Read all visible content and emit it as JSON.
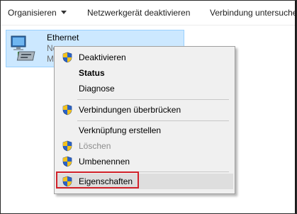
{
  "toolbar": {
    "organize_label": "Organisieren",
    "disable_label": "Netzwerkgerät deaktivieren",
    "diagnose_label": "Verbindung untersuche"
  },
  "network_item": {
    "name": "Ethernet",
    "status_partial": "Ne",
    "adapter_partial": "M"
  },
  "context_menu": {
    "items": [
      {
        "label": "Deaktivieren",
        "shield": true
      },
      {
        "label": "Status",
        "bold": true
      },
      {
        "label": "Diagnose"
      },
      {
        "label": "Verbindungen überbrücken",
        "shield": true
      },
      {
        "label": "Verknüpfung erstellen"
      },
      {
        "label": "Löschen",
        "shield": true,
        "disabled": true
      },
      {
        "label": "Umbenennen",
        "shield": true
      },
      {
        "label": "Eigenschaften",
        "shield": true,
        "highlighted": true
      }
    ]
  },
  "colors": {
    "selection_bg": "#cce8ff",
    "selection_border": "#99d1ff",
    "menu_bg": "#f0f0f0",
    "highlight_outline": "#d1222a",
    "shield_blue": "#2b63c6",
    "shield_yellow": "#f4c21b"
  }
}
